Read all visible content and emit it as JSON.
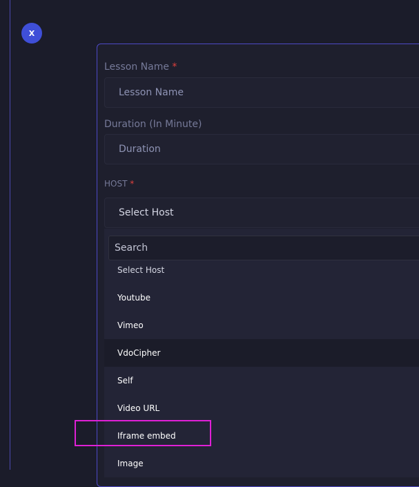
{
  "close_label": "X",
  "form": {
    "lesson_name_label": "Lesson Name",
    "lesson_name_placeholder": "Lesson Name",
    "duration_label": "Duration (In Minute)",
    "duration_placeholder": "Duration",
    "host_label": "HOST",
    "required_mark": "*",
    "host_selected": "Select Host"
  },
  "dropdown": {
    "search_placeholder": "Search",
    "options": [
      "Select Host",
      "Youtube",
      "Vimeo",
      "VdoCipher",
      "Self",
      "Video URL",
      "Iframe embed",
      "Image"
    ],
    "highlighted_index": 3,
    "annotated_option": "Iframe embed"
  },
  "colors": {
    "accent": "#3f4fd8",
    "border": "#4e4ac8",
    "required": "#e0413d",
    "annotation": "#e020d6"
  }
}
